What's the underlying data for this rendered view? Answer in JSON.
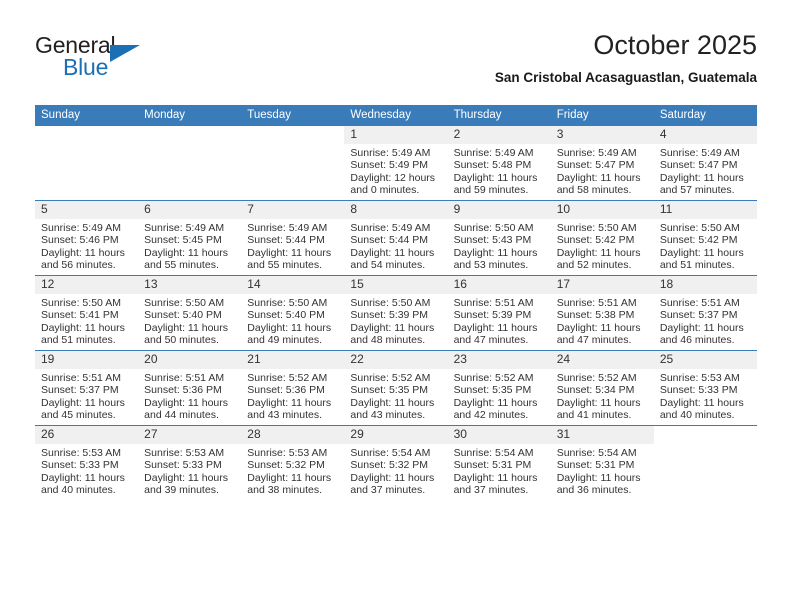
{
  "brand": {
    "name_top": "General",
    "name_bottom": "Blue",
    "accent_color": "#1b6fb5"
  },
  "header": {
    "month_title": "October 2025",
    "location": "San Cristobal Acasaguastlan, Guatemala"
  },
  "theme": {
    "header_bar": "#3a7cba",
    "daynum_band": "#f0f0f0",
    "row_rule": "#3a7cba"
  },
  "weekday_headers": [
    "Sunday",
    "Monday",
    "Tuesday",
    "Wednesday",
    "Thursday",
    "Friday",
    "Saturday"
  ],
  "labels": {
    "sunrise_prefix": "Sunrise:",
    "sunset_prefix": "Sunset:",
    "daylight_prefix": "Daylight:"
  },
  "weeks": [
    [
      {
        "day": "",
        "sunrise": "",
        "sunset": "",
        "daylight_line1": "",
        "daylight_line2": ""
      },
      {
        "day": "",
        "sunrise": "",
        "sunset": "",
        "daylight_line1": "",
        "daylight_line2": ""
      },
      {
        "day": "",
        "sunrise": "",
        "sunset": "",
        "daylight_line1": "",
        "daylight_line2": ""
      },
      {
        "day": "1",
        "sunrise": "Sunrise: 5:49 AM",
        "sunset": "Sunset: 5:49 PM",
        "daylight_line1": "Daylight: 12 hours",
        "daylight_line2": "and 0 minutes."
      },
      {
        "day": "2",
        "sunrise": "Sunrise: 5:49 AM",
        "sunset": "Sunset: 5:48 PM",
        "daylight_line1": "Daylight: 11 hours",
        "daylight_line2": "and 59 minutes."
      },
      {
        "day": "3",
        "sunrise": "Sunrise: 5:49 AM",
        "sunset": "Sunset: 5:47 PM",
        "daylight_line1": "Daylight: 11 hours",
        "daylight_line2": "and 58 minutes."
      },
      {
        "day": "4",
        "sunrise": "Sunrise: 5:49 AM",
        "sunset": "Sunset: 5:47 PM",
        "daylight_line1": "Daylight: 11 hours",
        "daylight_line2": "and 57 minutes."
      }
    ],
    [
      {
        "day": "5",
        "sunrise": "Sunrise: 5:49 AM",
        "sunset": "Sunset: 5:46 PM",
        "daylight_line1": "Daylight: 11 hours",
        "daylight_line2": "and 56 minutes."
      },
      {
        "day": "6",
        "sunrise": "Sunrise: 5:49 AM",
        "sunset": "Sunset: 5:45 PM",
        "daylight_line1": "Daylight: 11 hours",
        "daylight_line2": "and 55 minutes."
      },
      {
        "day": "7",
        "sunrise": "Sunrise: 5:49 AM",
        "sunset": "Sunset: 5:44 PM",
        "daylight_line1": "Daylight: 11 hours",
        "daylight_line2": "and 55 minutes."
      },
      {
        "day": "8",
        "sunrise": "Sunrise: 5:49 AM",
        "sunset": "Sunset: 5:44 PM",
        "daylight_line1": "Daylight: 11 hours",
        "daylight_line2": "and 54 minutes."
      },
      {
        "day": "9",
        "sunrise": "Sunrise: 5:50 AM",
        "sunset": "Sunset: 5:43 PM",
        "daylight_line1": "Daylight: 11 hours",
        "daylight_line2": "and 53 minutes."
      },
      {
        "day": "10",
        "sunrise": "Sunrise: 5:50 AM",
        "sunset": "Sunset: 5:42 PM",
        "daylight_line1": "Daylight: 11 hours",
        "daylight_line2": "and 52 minutes."
      },
      {
        "day": "11",
        "sunrise": "Sunrise: 5:50 AM",
        "sunset": "Sunset: 5:42 PM",
        "daylight_line1": "Daylight: 11 hours",
        "daylight_line2": "and 51 minutes."
      }
    ],
    [
      {
        "day": "12",
        "sunrise": "Sunrise: 5:50 AM",
        "sunset": "Sunset: 5:41 PM",
        "daylight_line1": "Daylight: 11 hours",
        "daylight_line2": "and 51 minutes."
      },
      {
        "day": "13",
        "sunrise": "Sunrise: 5:50 AM",
        "sunset": "Sunset: 5:40 PM",
        "daylight_line1": "Daylight: 11 hours",
        "daylight_line2": "and 50 minutes."
      },
      {
        "day": "14",
        "sunrise": "Sunrise: 5:50 AM",
        "sunset": "Sunset: 5:40 PM",
        "daylight_line1": "Daylight: 11 hours",
        "daylight_line2": "and 49 minutes."
      },
      {
        "day": "15",
        "sunrise": "Sunrise: 5:50 AM",
        "sunset": "Sunset: 5:39 PM",
        "daylight_line1": "Daylight: 11 hours",
        "daylight_line2": "and 48 minutes."
      },
      {
        "day": "16",
        "sunrise": "Sunrise: 5:51 AM",
        "sunset": "Sunset: 5:39 PM",
        "daylight_line1": "Daylight: 11 hours",
        "daylight_line2": "and 47 minutes."
      },
      {
        "day": "17",
        "sunrise": "Sunrise: 5:51 AM",
        "sunset": "Sunset: 5:38 PM",
        "daylight_line1": "Daylight: 11 hours",
        "daylight_line2": "and 47 minutes."
      },
      {
        "day": "18",
        "sunrise": "Sunrise: 5:51 AM",
        "sunset": "Sunset: 5:37 PM",
        "daylight_line1": "Daylight: 11 hours",
        "daylight_line2": "and 46 minutes."
      }
    ],
    [
      {
        "day": "19",
        "sunrise": "Sunrise: 5:51 AM",
        "sunset": "Sunset: 5:37 PM",
        "daylight_line1": "Daylight: 11 hours",
        "daylight_line2": "and 45 minutes."
      },
      {
        "day": "20",
        "sunrise": "Sunrise: 5:51 AM",
        "sunset": "Sunset: 5:36 PM",
        "daylight_line1": "Daylight: 11 hours",
        "daylight_line2": "and 44 minutes."
      },
      {
        "day": "21",
        "sunrise": "Sunrise: 5:52 AM",
        "sunset": "Sunset: 5:36 PM",
        "daylight_line1": "Daylight: 11 hours",
        "daylight_line2": "and 43 minutes."
      },
      {
        "day": "22",
        "sunrise": "Sunrise: 5:52 AM",
        "sunset": "Sunset: 5:35 PM",
        "daylight_line1": "Daylight: 11 hours",
        "daylight_line2": "and 43 minutes."
      },
      {
        "day": "23",
        "sunrise": "Sunrise: 5:52 AM",
        "sunset": "Sunset: 5:35 PM",
        "daylight_line1": "Daylight: 11 hours",
        "daylight_line2": "and 42 minutes."
      },
      {
        "day": "24",
        "sunrise": "Sunrise: 5:52 AM",
        "sunset": "Sunset: 5:34 PM",
        "daylight_line1": "Daylight: 11 hours",
        "daylight_line2": "and 41 minutes."
      },
      {
        "day": "25",
        "sunrise": "Sunrise: 5:53 AM",
        "sunset": "Sunset: 5:33 PM",
        "daylight_line1": "Daylight: 11 hours",
        "daylight_line2": "and 40 minutes."
      }
    ],
    [
      {
        "day": "26",
        "sunrise": "Sunrise: 5:53 AM",
        "sunset": "Sunset: 5:33 PM",
        "daylight_line1": "Daylight: 11 hours",
        "daylight_line2": "and 40 minutes."
      },
      {
        "day": "27",
        "sunrise": "Sunrise: 5:53 AM",
        "sunset": "Sunset: 5:33 PM",
        "daylight_line1": "Daylight: 11 hours",
        "daylight_line2": "and 39 minutes."
      },
      {
        "day": "28",
        "sunrise": "Sunrise: 5:53 AM",
        "sunset": "Sunset: 5:32 PM",
        "daylight_line1": "Daylight: 11 hours",
        "daylight_line2": "and 38 minutes."
      },
      {
        "day": "29",
        "sunrise": "Sunrise: 5:54 AM",
        "sunset": "Sunset: 5:32 PM",
        "daylight_line1": "Daylight: 11 hours",
        "daylight_line2": "and 37 minutes."
      },
      {
        "day": "30",
        "sunrise": "Sunrise: 5:54 AM",
        "sunset": "Sunset: 5:31 PM",
        "daylight_line1": "Daylight: 11 hours",
        "daylight_line2": "and 37 minutes."
      },
      {
        "day": "31",
        "sunrise": "Sunrise: 5:54 AM",
        "sunset": "Sunset: 5:31 PM",
        "daylight_line1": "Daylight: 11 hours",
        "daylight_line2": "and 36 minutes."
      },
      {
        "day": "",
        "sunrise": "",
        "sunset": "",
        "daylight_line1": "",
        "daylight_line2": ""
      }
    ]
  ]
}
